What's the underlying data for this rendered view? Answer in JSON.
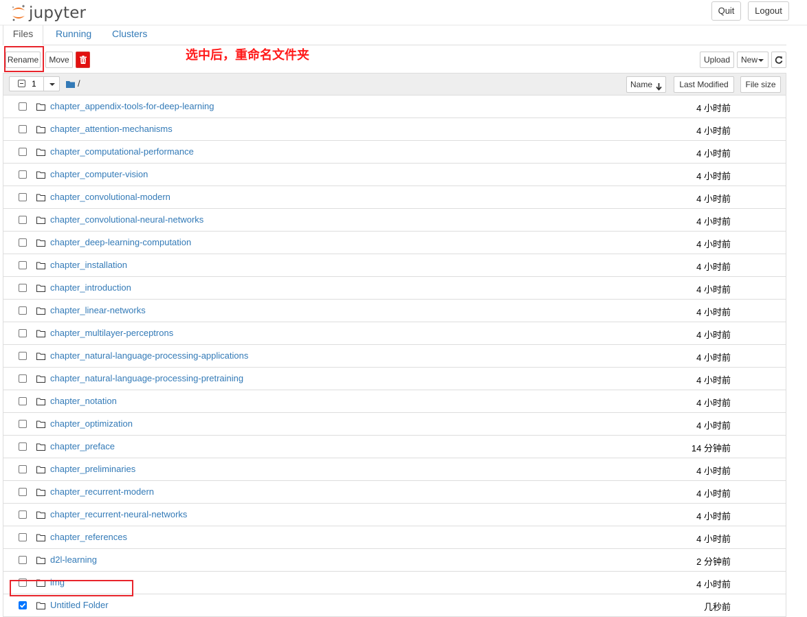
{
  "header": {
    "logo_text": "jupyter",
    "quit_label": "Quit",
    "logout_label": "Logout"
  },
  "tabs": [
    {
      "label": "Files",
      "active": true
    },
    {
      "label": "Running",
      "active": false
    },
    {
      "label": "Clusters",
      "active": false
    }
  ],
  "toolbar": {
    "rename_label": "Rename",
    "move_label": "Move",
    "delete_icon": "trash-icon",
    "upload_label": "Upload",
    "new_label": "New",
    "refresh_icon": "refresh-icon"
  },
  "annotation": {
    "text": "选中后，重命名文件夹",
    "color": "#ff1a1a"
  },
  "list_header": {
    "selected_count": "1",
    "path": "/",
    "sort_name_label": "Name",
    "last_modified_label": "Last Modified",
    "file_size_label": "File size"
  },
  "files": [
    {
      "name": "chapter_appendix-tools-for-deep-learning",
      "modified": "4 小时前",
      "checked": false
    },
    {
      "name": "chapter_attention-mechanisms",
      "modified": "4 小时前",
      "checked": false
    },
    {
      "name": "chapter_computational-performance",
      "modified": "4 小时前",
      "checked": false
    },
    {
      "name": "chapter_computer-vision",
      "modified": "4 小时前",
      "checked": false
    },
    {
      "name": "chapter_convolutional-modern",
      "modified": "4 小时前",
      "checked": false
    },
    {
      "name": "chapter_convolutional-neural-networks",
      "modified": "4 小时前",
      "checked": false
    },
    {
      "name": "chapter_deep-learning-computation",
      "modified": "4 小时前",
      "checked": false
    },
    {
      "name": "chapter_installation",
      "modified": "4 小时前",
      "checked": false
    },
    {
      "name": "chapter_introduction",
      "modified": "4 小时前",
      "checked": false
    },
    {
      "name": "chapter_linear-networks",
      "modified": "4 小时前",
      "checked": false
    },
    {
      "name": "chapter_multilayer-perceptrons",
      "modified": "4 小时前",
      "checked": false
    },
    {
      "name": "chapter_natural-language-processing-applications",
      "modified": "4 小时前",
      "checked": false
    },
    {
      "name": "chapter_natural-language-processing-pretraining",
      "modified": "4 小时前",
      "checked": false
    },
    {
      "name": "chapter_notation",
      "modified": "4 小时前",
      "checked": false
    },
    {
      "name": "chapter_optimization",
      "modified": "4 小时前",
      "checked": false
    },
    {
      "name": "chapter_preface",
      "modified": "14 分钟前",
      "checked": false
    },
    {
      "name": "chapter_preliminaries",
      "modified": "4 小时前",
      "checked": false
    },
    {
      "name": "chapter_recurrent-modern",
      "modified": "4 小时前",
      "checked": false
    },
    {
      "name": "chapter_recurrent-neural-networks",
      "modified": "4 小时前",
      "checked": false
    },
    {
      "name": "chapter_references",
      "modified": "4 小时前",
      "checked": false
    },
    {
      "name": "d2l-learning",
      "modified": "2 分钟前",
      "checked": false
    },
    {
      "name": "img",
      "modified": "4 小时前",
      "checked": false
    },
    {
      "name": "Untitled Folder",
      "modified": "几秒前",
      "checked": true
    }
  ]
}
